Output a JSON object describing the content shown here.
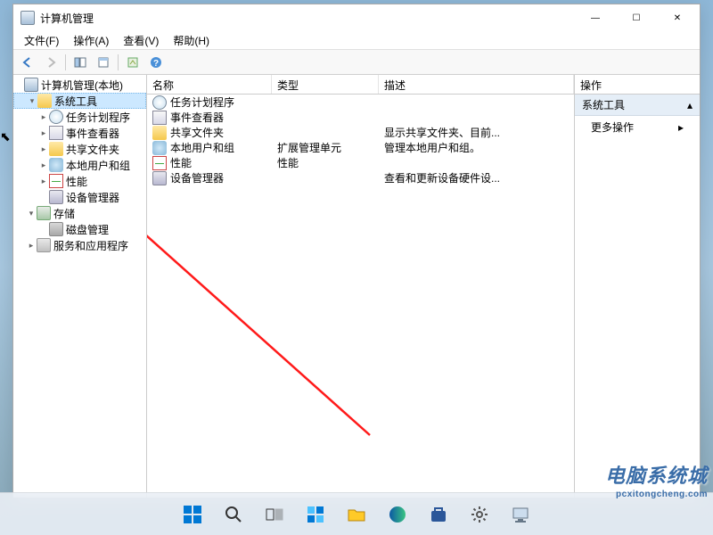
{
  "window": {
    "title": "计算机管理"
  },
  "menubar": {
    "file": "文件(F)",
    "action": "操作(A)",
    "view": "查看(V)",
    "help": "帮助(H)"
  },
  "toolbar": {
    "back": "back-icon",
    "forward": "forward-icon",
    "up": "up-icon",
    "properties": "properties-icon",
    "refresh": "refresh-icon",
    "export": "export-icon",
    "help": "help-icon"
  },
  "tree": {
    "root": "计算机管理(本地)",
    "system_tools": {
      "label": "系统工具",
      "items": [
        "任务计划程序",
        "事件查看器",
        "共享文件夹",
        "本地用户和组",
        "性能",
        "设备管理器"
      ]
    },
    "storage": {
      "label": "存储",
      "items": [
        "磁盘管理"
      ]
    },
    "services": {
      "label": "服务和应用程序"
    }
  },
  "list": {
    "columns": {
      "name": "名称",
      "type": "类型",
      "desc": "描述"
    },
    "rows": [
      {
        "name": "任务计划程序",
        "type": "",
        "desc": ""
      },
      {
        "name": "事件查看器",
        "type": "",
        "desc": ""
      },
      {
        "name": "共享文件夹",
        "type": "",
        "desc": "显示共享文件夹、目前..."
      },
      {
        "name": "本地用户和组",
        "type": "扩展管理单元",
        "desc": "管理本地用户和组。"
      },
      {
        "name": "性能",
        "type": "性能",
        "desc": ""
      },
      {
        "name": "设备管理器",
        "type": "",
        "desc": "查看和更新设备硬件设..."
      }
    ]
  },
  "actions": {
    "header": "操作",
    "section": "系统工具",
    "more": "更多操作"
  },
  "watermark": {
    "main": "电脑系统城",
    "sub": "pcxitongcheng.com"
  }
}
